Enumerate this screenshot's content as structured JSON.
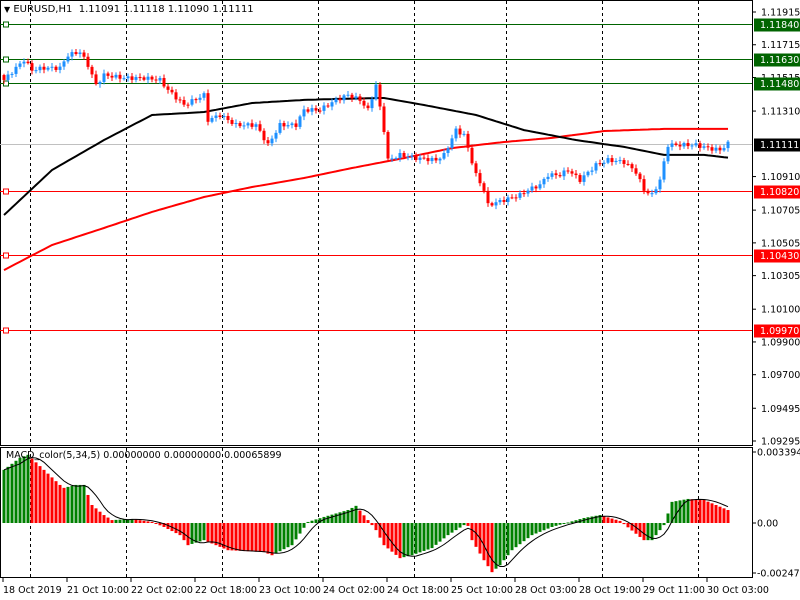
{
  "header": {
    "arrow": "▼",
    "symbol": "EURUSD,H1",
    "ohlc": "1.11091 1.11118 1.11090 1.11111"
  },
  "indicator": {
    "label": "MACD_color(5,34,5) 0.00000000 0.00000000 0.00065899"
  },
  "colors": {
    "bull": "#1e90ff",
    "bear": "#ff0000",
    "level_green": "#006400",
    "level_red": "#ff0000",
    "ma_fast": "#000000",
    "ma_slow": "#ff0000",
    "macd_up": "#008000",
    "macd_down": "#ff0000"
  },
  "price_axis": {
    "max": 1.11915,
    "min": 1.09295,
    "ticks": [
      "1.11915",
      "1.11715",
      "1.11515",
      "1.11310",
      "1.10910",
      "1.10705",
      "1.10505",
      "1.10305",
      "1.10100",
      "1.09900",
      "1.09700",
      "1.09495",
      "1.09295"
    ]
  },
  "levels": [
    {
      "price": 1.1184,
      "label": "1.11840",
      "kind": "green"
    },
    {
      "price": 1.1163,
      "label": "1.11630",
      "kind": "green"
    },
    {
      "price": 1.1148,
      "label": "1.11480",
      "kind": "green"
    },
    {
      "price": 1.1082,
      "label": "1.10820",
      "kind": "red"
    },
    {
      "price": 1.1043,
      "label": "1.10430",
      "kind": "red"
    },
    {
      "price": 1.0997,
      "label": "1.09970",
      "kind": "red"
    }
  ],
  "current_price": {
    "price": 1.11111,
    "label": "1.11111"
  },
  "macd_axis": {
    "max": 0.0033945,
    "min": -0.002474,
    "ticks": [
      "0.0033945",
      "0.00",
      "-0.002474"
    ]
  },
  "time_axis": {
    "labels": [
      "18 Oct 2019",
      "21 Oct 10:00",
      "22 Oct 02:00",
      "22 Oct 18:00",
      "23 Oct 10:00",
      "24 Oct 02:00",
      "24 Oct 18:00",
      "25 Oct 10:00",
      "28 Oct 03:00",
      "28 Oct 19:00",
      "29 Oct 11:00",
      "30 Oct 03:00"
    ],
    "day_separators": [
      7,
      31,
      55,
      79,
      103,
      126,
      150,
      174
    ]
  },
  "chart_data": {
    "type": "candlestick",
    "timeframe": "H1",
    "close_path": [
      [
        0,
        1.115
      ],
      [
        5,
        1.11622
      ],
      [
        7,
        1.11561
      ],
      [
        10,
        1.11573
      ],
      [
        14,
        1.11573
      ],
      [
        16,
        1.11652
      ],
      [
        19,
        1.11671
      ],
      [
        21,
        1.11591
      ],
      [
        23,
        1.11469
      ],
      [
        25,
        1.1153
      ],
      [
        30,
        1.11512
      ],
      [
        35,
        1.11512
      ],
      [
        39,
        1.115
      ],
      [
        41,
        1.11439
      ],
      [
        45,
        1.11347
      ],
      [
        50,
        1.11408
      ],
      [
        51,
        1.11255
      ],
      [
        54,
        1.11286
      ],
      [
        58,
        1.11225
      ],
      [
        63,
        1.11225
      ],
      [
        66,
        1.11103
      ],
      [
        69,
        1.11225
      ],
      [
        73,
        1.11225
      ],
      [
        75,
        1.11317
      ],
      [
        79,
        1.11317
      ],
      [
        83,
        1.11378
      ],
      [
        86,
        1.11408
      ],
      [
        89,
        1.11378
      ],
      [
        91,
        1.11317
      ],
      [
        93,
        1.11469
      ],
      [
        95,
        1.11194
      ],
      [
        96,
        1.11011
      ],
      [
        99,
        1.11042
      ],
      [
        103,
        1.11023
      ],
      [
        108,
        1.11011
      ],
      [
        110,
        1.11042
      ],
      [
        113,
        1.11194
      ],
      [
        115,
        1.11164
      ],
      [
        118,
        1.1092
      ],
      [
        120,
        1.10828
      ],
      [
        121,
        1.10736
      ],
      [
        125,
        1.10767
      ],
      [
        129,
        1.10797
      ],
      [
        131,
        1.10828
      ],
      [
        134,
        1.10859
      ],
      [
        136,
        1.1092
      ],
      [
        139,
        1.1092
      ],
      [
        141,
        1.1095
      ],
      [
        144,
        1.10889
      ],
      [
        148,
        1.10981
      ],
      [
        151,
        1.11011
      ],
      [
        155,
        1.10999
      ],
      [
        158,
        1.10938
      ],
      [
        160,
        1.10828
      ],
      [
        162,
        1.10797
      ],
      [
        164,
        1.10889
      ],
      [
        166,
        1.11103
      ],
      [
        169,
        1.11103
      ],
      [
        173,
        1.11103
      ],
      [
        176,
        1.11084
      ],
      [
        179,
        1.11072
      ],
      [
        181,
        1.11111
      ]
    ],
    "ma_fast": [
      [
        0,
        1.10675
      ],
      [
        12,
        1.1095
      ],
      [
        25,
        1.11133
      ],
      [
        37,
        1.11286
      ],
      [
        50,
        1.11304
      ],
      [
        62,
        1.11359
      ],
      [
        75,
        1.11378
      ],
      [
        83,
        1.11384
      ],
      [
        95,
        1.1139
      ],
      [
        105,
        1.11347
      ],
      [
        118,
        1.11286
      ],
      [
        130,
        1.11194
      ],
      [
        143,
        1.11133
      ],
      [
        155,
        1.11091
      ],
      [
        165,
        1.11042
      ],
      [
        175,
        1.11042
      ],
      [
        182,
        1.11023
      ]
    ],
    "ma_slow": [
      [
        0,
        1.10339
      ],
      [
        12,
        1.10492
      ],
      [
        25,
        1.10596
      ],
      [
        37,
        1.10694
      ],
      [
        50,
        1.10785
      ],
      [
        62,
        1.10846
      ],
      [
        75,
        1.10901
      ],
      [
        87,
        1.10962
      ],
      [
        100,
        1.11023
      ],
      [
        112,
        1.11084
      ],
      [
        125,
        1.11121
      ],
      [
        137,
        1.11146
      ],
      [
        150,
        1.11188
      ],
      [
        165,
        1.11201
      ],
      [
        182,
        1.11201
      ]
    ],
    "macd_hist": [
      [
        0,
        0.00254
      ],
      [
        4,
        0.00312
      ],
      [
        6,
        0.00326
      ],
      [
        10,
        0.00254
      ],
      [
        14,
        0.00182
      ],
      [
        15,
        0.00168
      ],
      [
        18,
        0.00182
      ],
      [
        20,
        0.00182
      ],
      [
        22,
        0.00086
      ],
      [
        25,
        0.00038
      ],
      [
        27,
        0.00014
      ],
      [
        32,
        0.00019
      ],
      [
        37,
        5e-05
      ],
      [
        40,
        -0.00019
      ],
      [
        44,
        -0.00058
      ],
      [
        46,
        -0.00106
      ],
      [
        50,
        -0.00082
      ],
      [
        56,
        -0.0013
      ],
      [
        65,
        -0.00139
      ],
      [
        67,
        -0.00154
      ],
      [
        72,
        -0.00106
      ],
      [
        76,
        5e-05
      ],
      [
        80,
        0.00029
      ],
      [
        86,
        0.00062
      ],
      [
        88,
        0.00082
      ],
      [
        91,
        0.00014
      ],
      [
        93,
        -0.00034
      ],
      [
        95,
        -0.00106
      ],
      [
        99,
        -0.00168
      ],
      [
        102,
        -0.00154
      ],
      [
        107,
        -0.0012
      ],
      [
        111,
        -0.00058
      ],
      [
        115,
        -0.0001
      ],
      [
        116,
        -0.00014
      ],
      [
        117,
        -0.00082
      ],
      [
        120,
        -0.00178
      ],
      [
        122,
        -0.00235
      ],
      [
        124,
        -0.00202
      ],
      [
        127,
        -0.0013
      ],
      [
        132,
        -0.00058
      ],
      [
        137,
        -0.00019
      ],
      [
        145,
        0.00024
      ],
      [
        149,
        0.00038
      ],
      [
        154,
        0.0001
      ],
      [
        160,
        -0.00082
      ],
      [
        162,
        -0.00082
      ],
      [
        165,
        -0.0001
      ],
      [
        167,
        0.00101
      ],
      [
        171,
        0.00115
      ],
      [
        175,
        0.0011
      ],
      [
        181,
        0.00062
      ]
    ]
  }
}
